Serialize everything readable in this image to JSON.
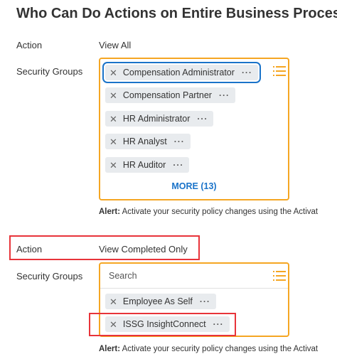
{
  "page": {
    "title": "Who Can Do Actions on Entire Business Process"
  },
  "section1": {
    "action_label": "Action",
    "action_value": "View All",
    "groups_label": "Security Groups",
    "groups": [
      "Compensation Administrator",
      "Compensation Partner",
      "HR Administrator",
      "HR Analyst",
      "HR Auditor"
    ],
    "more_label": "MORE (13)",
    "alert_prefix": "Alert:",
    "alert_text": "Activate your security policy changes using the Activat"
  },
  "section2": {
    "action_label": "Action",
    "action_value": "View Completed Only",
    "groups_label": "Security Groups",
    "search_placeholder": "Search",
    "groups": [
      "Employee As Self",
      "ISSG InsightConnect"
    ],
    "alert_prefix": "Alert:",
    "alert_text": "Activate your security policy changes using the Activat"
  },
  "icons": {
    "remove": "close-icon",
    "options": "ellipsis-icon",
    "prompt": "list-icon"
  },
  "colors": {
    "prompt_border": "#f5a623",
    "focus": "#1a73c9",
    "highlight": "#e8343a",
    "link": "#1a73c9"
  }
}
